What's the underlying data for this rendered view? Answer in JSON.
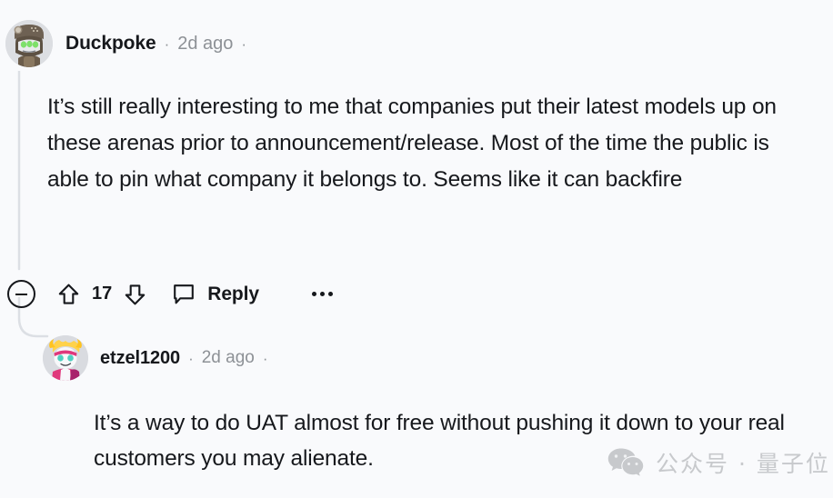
{
  "theme": {
    "background": "#f9fafc",
    "text_primary": "#16181c",
    "text_muted": "#8d9196",
    "thread_line": "#d9dde2",
    "watermark": "#c7c9cc"
  },
  "comments": [
    {
      "id": "comment-parent",
      "avatar_name": "avatar-duckpoke",
      "username": "Duckpoke",
      "separator": "·",
      "timestamp": "2d ago",
      "trailing_separator": "·",
      "body": "It’s still really interesting to me that companies put their latest models up on these arenas prior to announcement/release. Most of the time the public is able to pin what company it belongs to. Seems like it can backfire",
      "actions": {
        "collapse_label": "collapse-thread",
        "upvote_label": "upvote",
        "score": "17",
        "downvote_label": "downvote",
        "reply_label": "Reply",
        "more_label": "more-options"
      }
    },
    {
      "id": "comment-child",
      "avatar_name": "avatar-etzel1200",
      "username": "etzel1200",
      "separator": "·",
      "timestamp": "2d ago",
      "trailing_separator": "·",
      "body": "It’s a way to do UAT almost for free without pushing it down to your real customers you may alienate."
    }
  ],
  "watermark": {
    "icon": "wechat-icon",
    "text": "公众号 · 量子位"
  }
}
